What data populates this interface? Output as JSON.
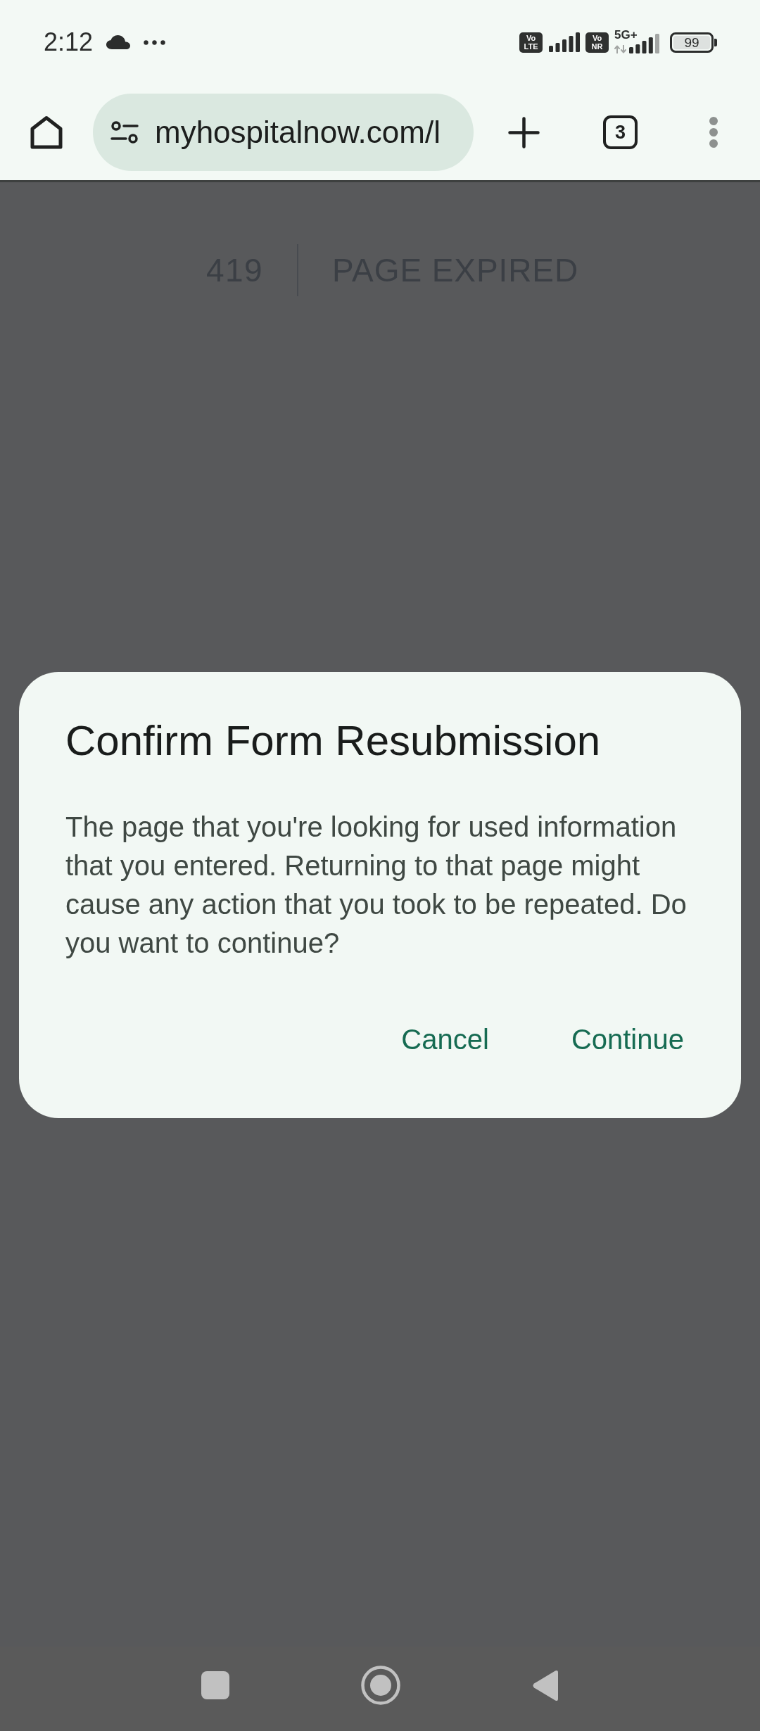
{
  "status_bar": {
    "time": "2:12",
    "sims": [
      {
        "badge_top": "Vo",
        "badge_bottom": "LTE"
      },
      {
        "badge_top": "Vo",
        "badge_bottom": "NR",
        "network_type": "5G+"
      }
    ],
    "battery": "99"
  },
  "toolbar": {
    "url": "myhospitalnow.com/l",
    "tab_count": "3"
  },
  "page": {
    "code": "419",
    "message": "PAGE EXPIRED"
  },
  "dialog": {
    "title": "Confirm Form Resubmission",
    "message": "The page that you're looking for used information that you entered. Returning to that page might cause any action that you took to be repeated. Do you want to continue?",
    "buttons": [
      {
        "label": "Cancel"
      },
      {
        "label": "Continue"
      }
    ]
  }
}
